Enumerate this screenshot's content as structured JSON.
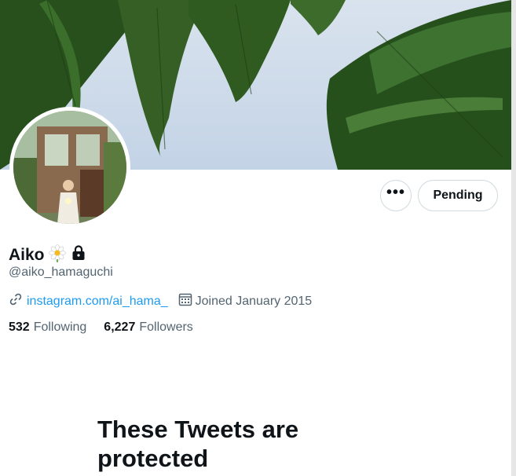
{
  "profile": {
    "display_name": "Aiko",
    "handle": "@aiko_hamaguchi",
    "website": "instagram.com/ai_hama_",
    "joined": "Joined January 2015",
    "following_count": "532",
    "following_label": "Following",
    "followers_count": "6,227",
    "followers_label": "Followers"
  },
  "actions": {
    "more_label": "•••",
    "pending_label": "Pending"
  },
  "protected": {
    "title": "These Tweets are protected"
  },
  "icons": [
    "daisy-icon",
    "lock-icon",
    "link-icon",
    "calendar-icon",
    "more-icon"
  ],
  "colors": {
    "text": "#0f1419",
    "secondary": "#536471",
    "link": "#1d9bf0",
    "border": "#cfd9de",
    "banner_sky": "#cfdcea",
    "fern_green": "#2f5a22"
  }
}
